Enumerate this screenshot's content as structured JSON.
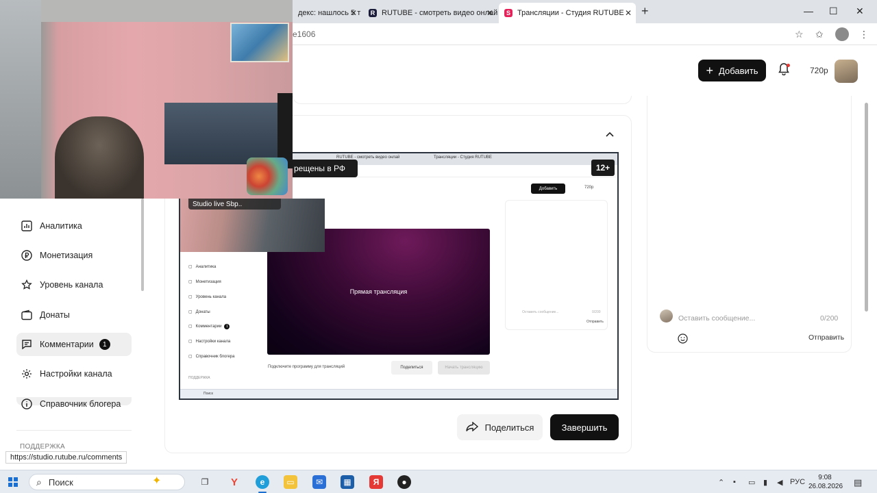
{
  "browser": {
    "tabs": [
      {
        "label": "дeкс: нашлось 5 т",
        "favicon": "yandex-favicon"
      },
      {
        "label": "RUTUBE - смотреть видео онлай",
        "favicon": "rutube-favicon"
      },
      {
        "label": "Трансляции - Студия RUTUBE",
        "favicon": "studio-favicon"
      }
    ],
    "address_fragment": "e1606",
    "new_tab": "+",
    "window_controls": {
      "minimize": "—",
      "maximize": "☐",
      "close": "✕"
    }
  },
  "header": {
    "add_label": "Добавить",
    "quality": "720p"
  },
  "sidebar": {
    "items": [
      {
        "label": "Аналитика",
        "icon": "analytics-icon"
      },
      {
        "label": "Монетизация",
        "icon": "ruble-icon"
      },
      {
        "label": "Уровень канала",
        "icon": "star-icon"
      },
      {
        "label": "Донаты",
        "icon": "wallet-icon"
      },
      {
        "label": "Комментарии",
        "icon": "comment-icon",
        "badge": "1"
      },
      {
        "label": "Настройки канала",
        "icon": "gear-icon"
      },
      {
        "label": "Справочник блогера",
        "icon": "info-icon"
      }
    ],
    "support_label": "ПОДДЕРЖКА"
  },
  "main": {
    "share_label": "Поделиться",
    "finish_label": "Завершить"
  },
  "chat": {
    "placeholder": "Оставить сообщение...",
    "counter": "0/200",
    "send_label": "Отправить"
  },
  "preview": {
    "overlay_label": "рещены в РФ",
    "rating": "12+",
    "webcam_bar": "Studio live Sbp..",
    "video_title": "Прямая трансляция",
    "tabs": [
      "RUTUBE - смотреть видео онлай",
      "Трансляции - Студия RUTUBE"
    ],
    "add_label": "Добавить",
    "quality": "720p",
    "menu": [
      "Аналитика",
      "Монетизация",
      "Уровень канала",
      "Донаты",
      "Комментарии",
      "Настройки канала",
      "Справочник блогера"
    ],
    "menu_badge": "1",
    "support_label": "ПОДДЕРЖКА",
    "chat_placeholder": "Оставить сообщение...",
    "chat_counter": "0/200",
    "chat_send": "Отправить",
    "connect_label": "Подключите программу для трансляций",
    "share_label": "Поделиться",
    "start_label": "Начать трансляцию",
    "taskbar_search": "Поиск"
  },
  "status_url": "https://studio.rutube.ru/comments",
  "taskbar": {
    "search_label": "Поиск",
    "language": "РУС",
    "time": "9:08",
    "date": "26.08.2026"
  },
  "colors": {
    "accent": "#111111",
    "badge": "#111111",
    "notification_dot": "#e53935",
    "video_gradient": "#3b0a35"
  }
}
